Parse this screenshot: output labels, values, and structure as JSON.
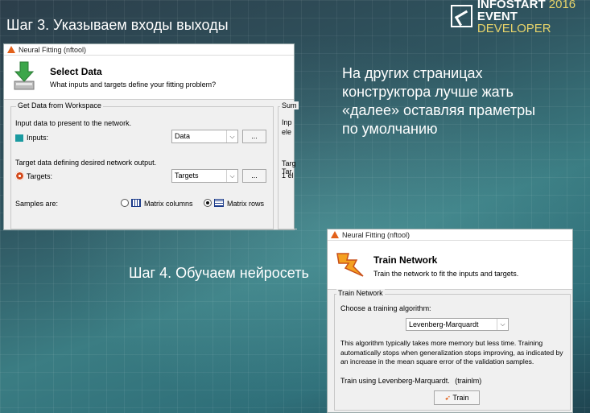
{
  "slide": {
    "step3_title": "Шаг 3. Указываем входы выходы",
    "step4_title": "Шаг 4. Обучаем нейросеть",
    "note": "На других страницах конструктора лучше жать «далее» оставляя праметры по умолчанию",
    "logo": {
      "line1": "INFOSTART",
      "year": "2016",
      "line2": "EVENT",
      "tag": "DEVELOPER"
    }
  },
  "select_data_window": {
    "title": "Neural Fitting (nftool)",
    "header_title": "Select Data",
    "header_subtitle": "What inputs and targets define your fitting problem?",
    "group_label": "Get Data from Workspace",
    "summary_label": "Sum",
    "summary_lines": [
      "Inp",
      "ele",
      "Targ",
      "Tar",
      "1 el"
    ],
    "inputs_desc": "Input data to present to the network.",
    "inputs_label": "Inputs:",
    "inputs_value": "Data",
    "targets_desc": "Target data defining desired network output.",
    "targets_label": "Targets:",
    "targets_value": "Targets",
    "browse_label": "...",
    "samples_label": "Samples are:",
    "matrix_columns": "Matrix columns",
    "matrix_rows": "Matrix rows",
    "selected_orientation": "Matrix rows"
  },
  "train_window": {
    "title": "Neural Fitting (nftool)",
    "header_title": "Train Network",
    "header_subtitle": "Train the network to fit the inputs and targets.",
    "group_label": "Train Network",
    "choose_label": "Choose a training algorithm:",
    "algorithm_value": "Levenberg-Marquardt",
    "description": "This algorithm typically takes more memory but less time. Training automatically stops when generalization stops improving, as indicated by an increase in the mean square error of the validation samples.",
    "train_using": "Train using Levenberg-Marquardt.",
    "train_fn": "(trainlm)",
    "train_button": "Train"
  },
  "colors": {
    "matlab_orange": "#e2611b",
    "input_icon": "#1a9aa0",
    "logo_accent": "#e8d46a"
  }
}
